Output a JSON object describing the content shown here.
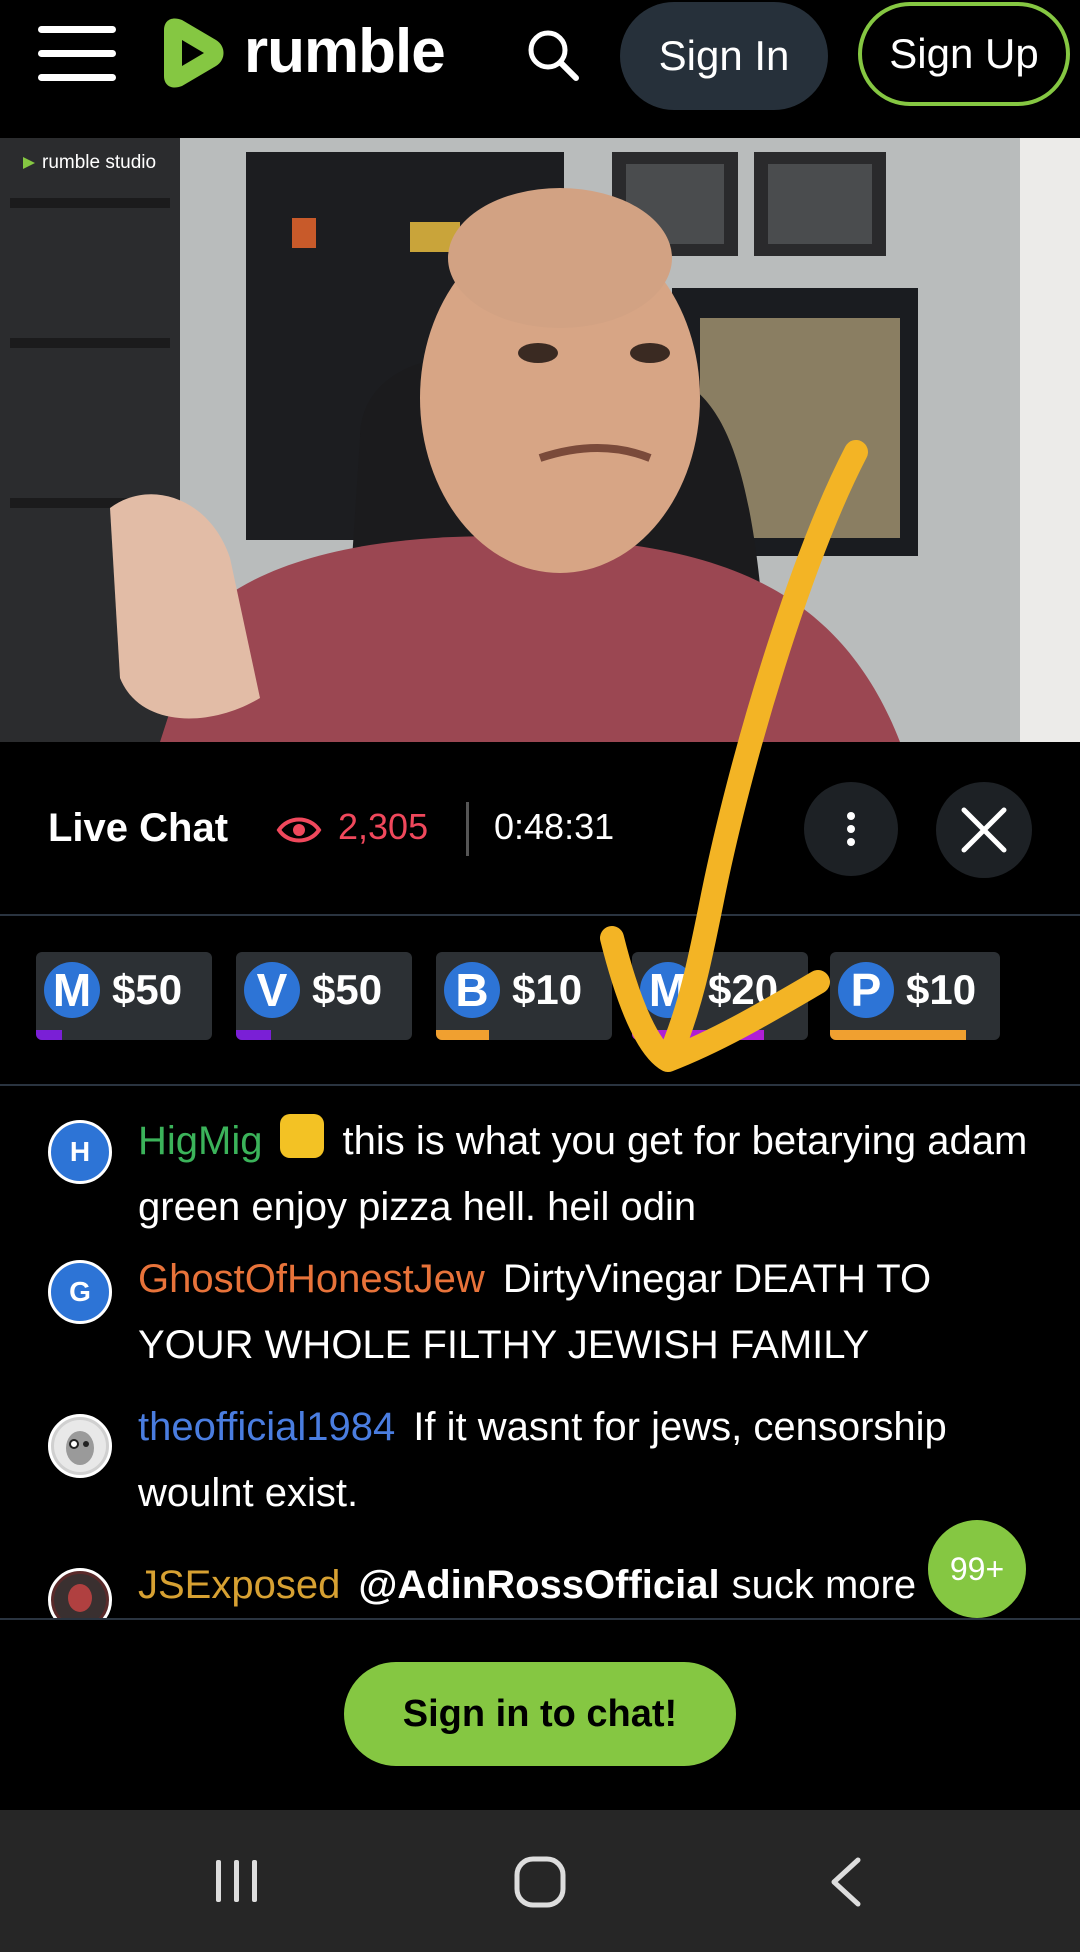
{
  "header": {
    "brand": "rumble",
    "signin_label": "Sign In",
    "signup_label": "Sign Up"
  },
  "video": {
    "badge": "rumble studio"
  },
  "live_chat": {
    "title": "Live Chat",
    "viewers": "2,305",
    "elapsed": "0:48:31"
  },
  "rants": [
    {
      "initial": "M",
      "amount": "$50",
      "bar_color": "#7a1fd6",
      "progress": 0.15
    },
    {
      "initial": "V",
      "amount": "$50",
      "bar_color": "#7a1fd6",
      "progress": 0.2
    },
    {
      "initial": "B",
      "amount": "$10",
      "bar_color": "#f0a030",
      "progress": 0.3
    },
    {
      "initial": "M",
      "amount": "$20",
      "bar_color": "#b01fd6",
      "progress": 0.75
    },
    {
      "initial": "P",
      "amount": "$10",
      "bar_color": "#f0a030",
      "progress": 0.8
    }
  ],
  "messages": [
    {
      "avatar": "H",
      "user": "HigMig",
      "user_color": "#3bb35a",
      "text": "this is what you get for betarying adam green enjoy pizza hell. heil odin"
    },
    {
      "avatar": "G",
      "user": "GhostOfHonestJew",
      "user_color": "#e8733a",
      "text": "DirtyVinegar DEATH TO YOUR WHOLE FILTHY JEWISH FAMILY"
    },
    {
      "avatar": "",
      "user": "theofficial1984",
      "user_color": "#4a7de0",
      "text": "If it wasnt for jews, censorship woulnt exist."
    },
    {
      "avatar": "",
      "user": "JSExposed",
      "user_color": "#d7a132",
      "mention": "@AdinRossOfficial",
      "text": "suck more"
    }
  ],
  "new_count": "99+",
  "signin_chat_label": "Sign in to chat!",
  "colors": {
    "brand_green": "#85c742",
    "viewer_red": "#f0485c",
    "annotation_yellow": "#f3b425"
  }
}
